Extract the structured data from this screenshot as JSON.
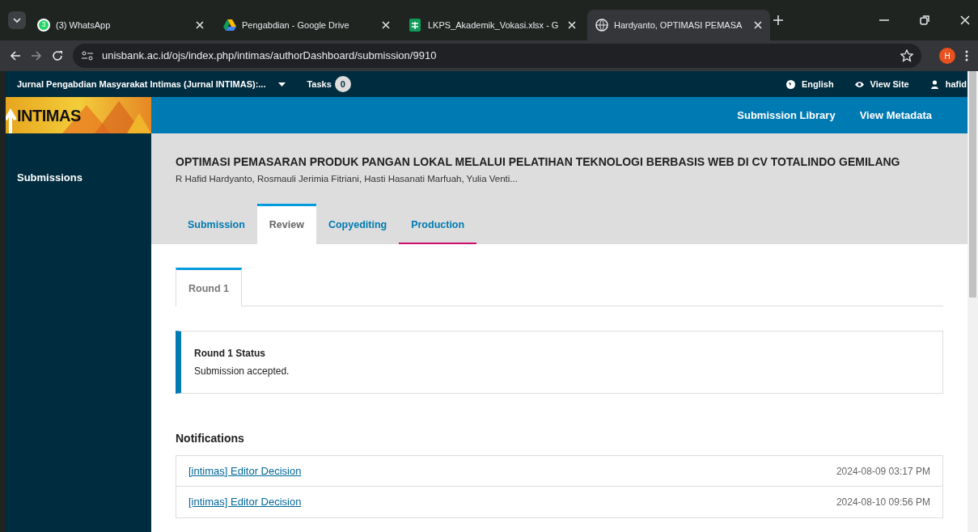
{
  "browser": {
    "tabs": [
      {
        "title": "(3) WhatsApp",
        "badge": "3",
        "kind": "chat",
        "selected": false
      },
      {
        "title": "Pengabdian - Google Drive",
        "kind": "drive",
        "selected": false
      },
      {
        "title": "LKPS_Akademik_Vokasi.xlsx - G",
        "kind": "sheet",
        "selected": false
      },
      {
        "title": "Hardyanto, OPTIMASI PEMASA",
        "kind": "web",
        "selected": true
      }
    ],
    "url": "unisbank.ac.id/ojs/index.php/intimas/authorDashboard/submission/9910",
    "profile_initial": "H"
  },
  "topbar": {
    "journal": "Jurnal Pengabdian Masyarakat Intimas (Jurnal INTIMAS):...",
    "tasks_label": "Tasks",
    "tasks_count": "0",
    "language": "English",
    "view_site": "View Site",
    "user": "hafid"
  },
  "logo": {
    "text": "INTIMAS"
  },
  "sidebar": {
    "items": [
      {
        "label": "Submissions"
      }
    ]
  },
  "actions": [
    "Submission Library",
    "View Metadata"
  ],
  "submission": {
    "title": "OPTIMASI PEMASARAN PRODUK PANGAN LOKAL MELALUI PELATIHAN TEKNOLOGI BERBASIS WEB DI CV TOTALINDO GEMILANG",
    "authors": "R Hafid Hardyanto, Rosmauli Jerimia Fitriani, Hasti Hasanati Marfuah, Yulia Venti..."
  },
  "stage_tabs": [
    {
      "label": "Submission",
      "selected": false,
      "current": false
    },
    {
      "label": "Review",
      "selected": true,
      "current": false
    },
    {
      "label": "Copyediting",
      "selected": false,
      "current": false
    },
    {
      "label": "Production",
      "selected": false,
      "current": true
    }
  ],
  "round_tabs": [
    {
      "label": "Round 1",
      "selected": true
    }
  ],
  "round_status": {
    "title": "Round 1 Status",
    "text": "Submission accepted."
  },
  "notifications": {
    "heading": "Notifications",
    "items": [
      {
        "subject": "[intimas] Editor Decision",
        "date": "2024-08-09 03:17 PM"
      },
      {
        "subject": "[intimas] Editor Decision",
        "date": "2024-08-10 09:56 PM"
      }
    ]
  }
}
